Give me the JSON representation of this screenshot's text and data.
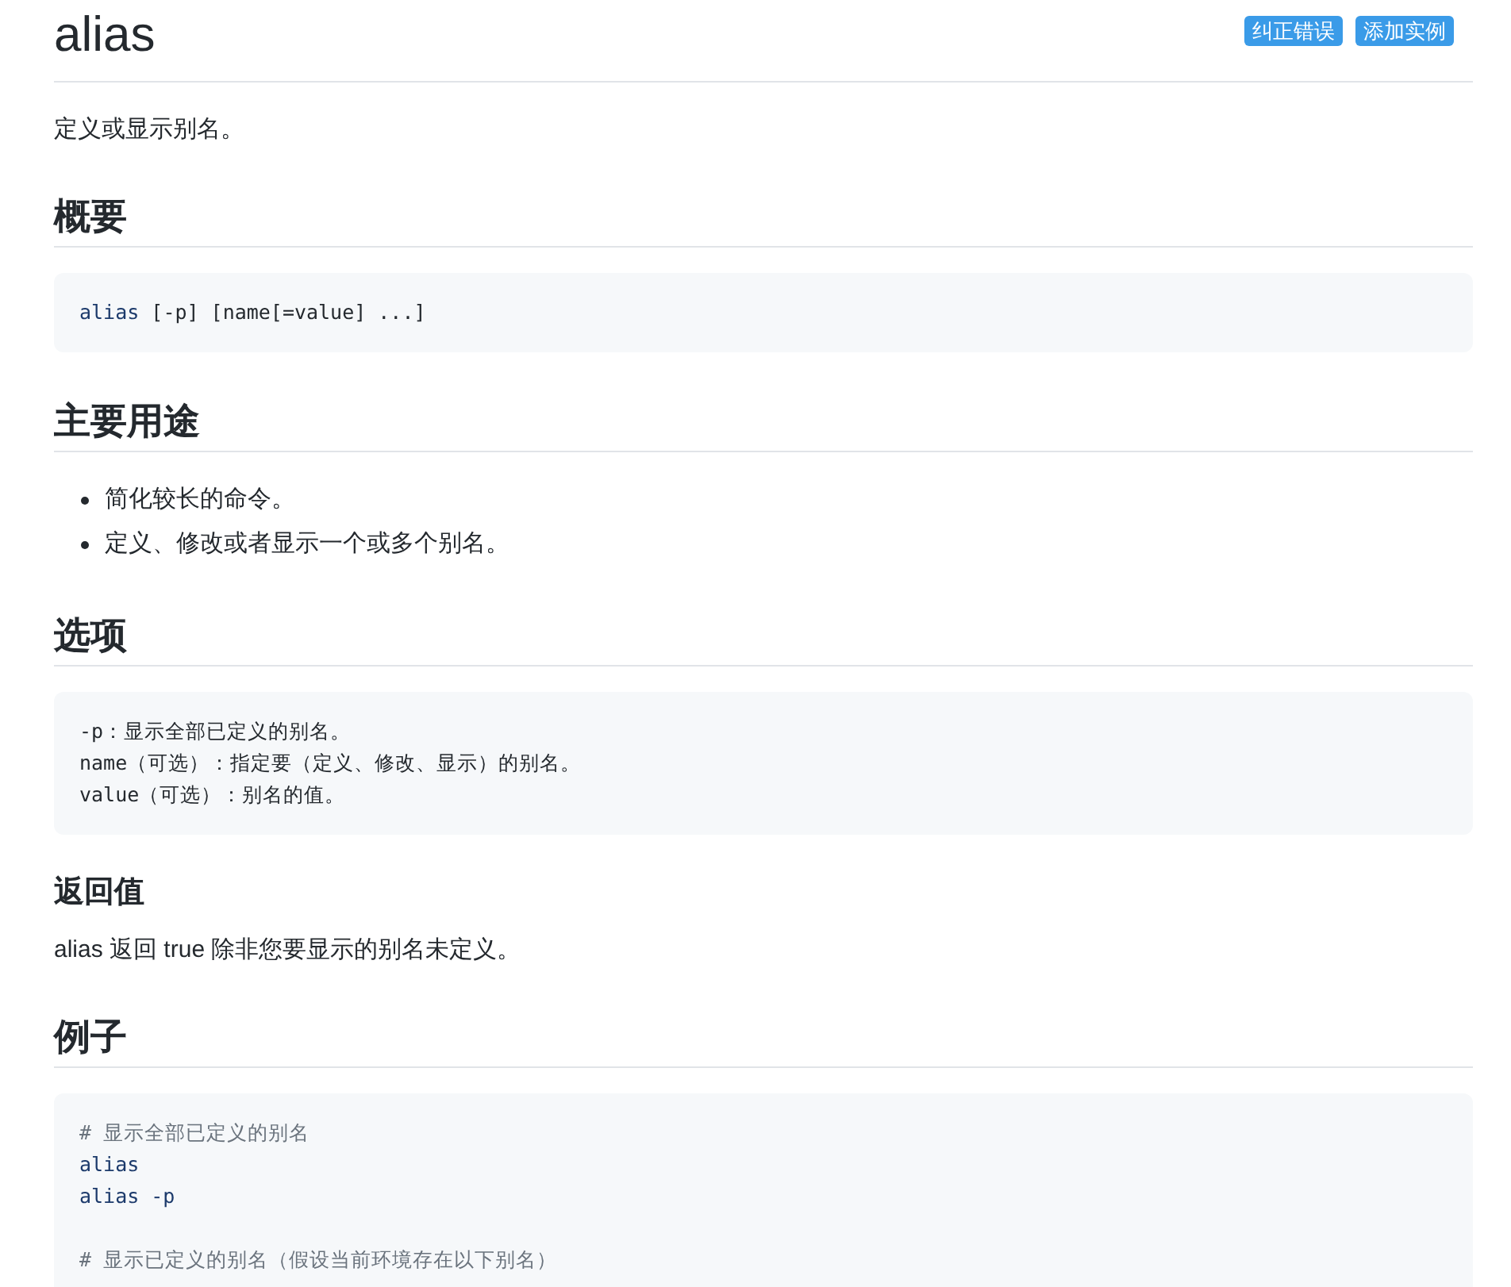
{
  "title": "alias",
  "actions": [
    {
      "label": "纠正错误"
    },
    {
      "label": "添加实例"
    }
  ],
  "description": "定义或显示别名。",
  "sections": [
    {
      "heading": "概要",
      "kind": "major",
      "blocks": [
        {
          "kind": "code",
          "lines": [
            {
              "tokens": [
                {
                  "kind": "command",
                  "text": "alias"
                },
                {
                  "kind": "plain",
                  "text": " [-p] [name[=value] ...]"
                }
              ]
            }
          ]
        }
      ]
    },
    {
      "heading": "主要用途",
      "kind": "major",
      "blocks": [
        {
          "kind": "list",
          "items": [
            "简化较长的命令。",
            "定义、修改或者显示一个或多个别名。"
          ]
        }
      ]
    },
    {
      "heading": "选项",
      "kind": "major",
      "blocks": [
        {
          "kind": "code",
          "lines": [
            {
              "tokens": [
                {
                  "kind": "plain",
                  "text": "-p：显示全部已定义的别名。"
                }
              ]
            },
            {
              "tokens": [
                {
                  "kind": "plain",
                  "text": "name（可选）：指定要（定义、修改、显示）的别名。"
                }
              ]
            },
            {
              "tokens": [
                {
                  "kind": "plain",
                  "text": "value（可选）：别名的值。"
                }
              ]
            }
          ]
        }
      ]
    },
    {
      "heading": "返回值",
      "kind": "minor",
      "blocks": [
        {
          "kind": "paragraph",
          "text": "alias 返回 true 除非您要显示的别名未定义。"
        }
      ]
    },
    {
      "heading": "例子",
      "kind": "major",
      "blocks": [
        {
          "kind": "code",
          "lines": [
            {
              "tokens": [
                {
                  "kind": "comment",
                  "text": "# 显示全部已定义的别名"
                }
              ]
            },
            {
              "tokens": [
                {
                  "kind": "command",
                  "text": "alias"
                }
              ]
            },
            {
              "tokens": [
                {
                  "kind": "command",
                  "text": "alias -p"
                }
              ]
            },
            {
              "kind": "blank"
            },
            {
              "tokens": [
                {
                  "kind": "comment",
                  "text": "# 显示已定义的别名（假设当前环境存在以下别名）"
                }
              ]
            }
          ]
        }
      ]
    }
  ]
}
